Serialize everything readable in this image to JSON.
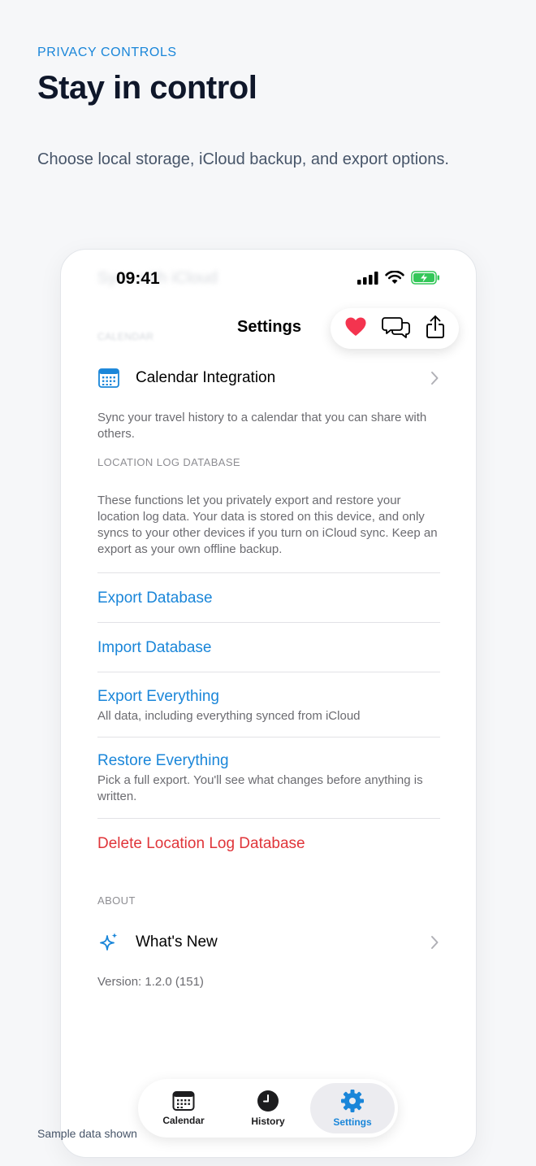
{
  "marketing": {
    "eyebrow": "PRIVACY CONTROLS",
    "headline": "Stay in control",
    "subline": "Choose local storage, iCloud backup, and export options.",
    "footnote": "Sample data shown"
  },
  "status_bar": {
    "time": "09:41",
    "ghost_title": "Sync with iCloud"
  },
  "nav": {
    "title": "Settings",
    "ghost_section": "CALENDAR",
    "actions": [
      "heart-icon",
      "chat-bubbles-icon",
      "share-icon"
    ]
  },
  "calendar_section": {
    "row_label": "Calendar Integration",
    "footer": "Sync your travel history to a calendar that you can share with others."
  },
  "database_section": {
    "header": "LOCATION LOG DATABASE",
    "description": "These functions let you privately export and restore your location log data. Your data is stored on this device, and only syncs to your other devices if you turn on iCloud sync. Keep an export as your own offline backup.",
    "actions": [
      {
        "title": "Export Database",
        "subtitle": ""
      },
      {
        "title": "Import Database",
        "subtitle": ""
      },
      {
        "title": "Export Everything",
        "subtitle": "All data, including everything synced from iCloud"
      },
      {
        "title": "Restore Everything",
        "subtitle": "Pick a full export. You'll see what changes before anything is written."
      }
    ],
    "delete_label": "Delete Location Log Database"
  },
  "about_section": {
    "header": "ABOUT",
    "row_label": "What's New",
    "version": "Version: 1.2.0 (151)"
  },
  "tabbar": {
    "tabs": [
      {
        "label": "Calendar",
        "icon": "calendar-icon",
        "active": false
      },
      {
        "label": "History",
        "icon": "clock-icon",
        "active": false
      },
      {
        "label": "Settings",
        "icon": "gear-icon",
        "active": true
      }
    ]
  },
  "colors": {
    "accent": "#1a86d9",
    "destructive": "#e0353a",
    "heart": "#f4344f",
    "battery": "#34c759"
  }
}
